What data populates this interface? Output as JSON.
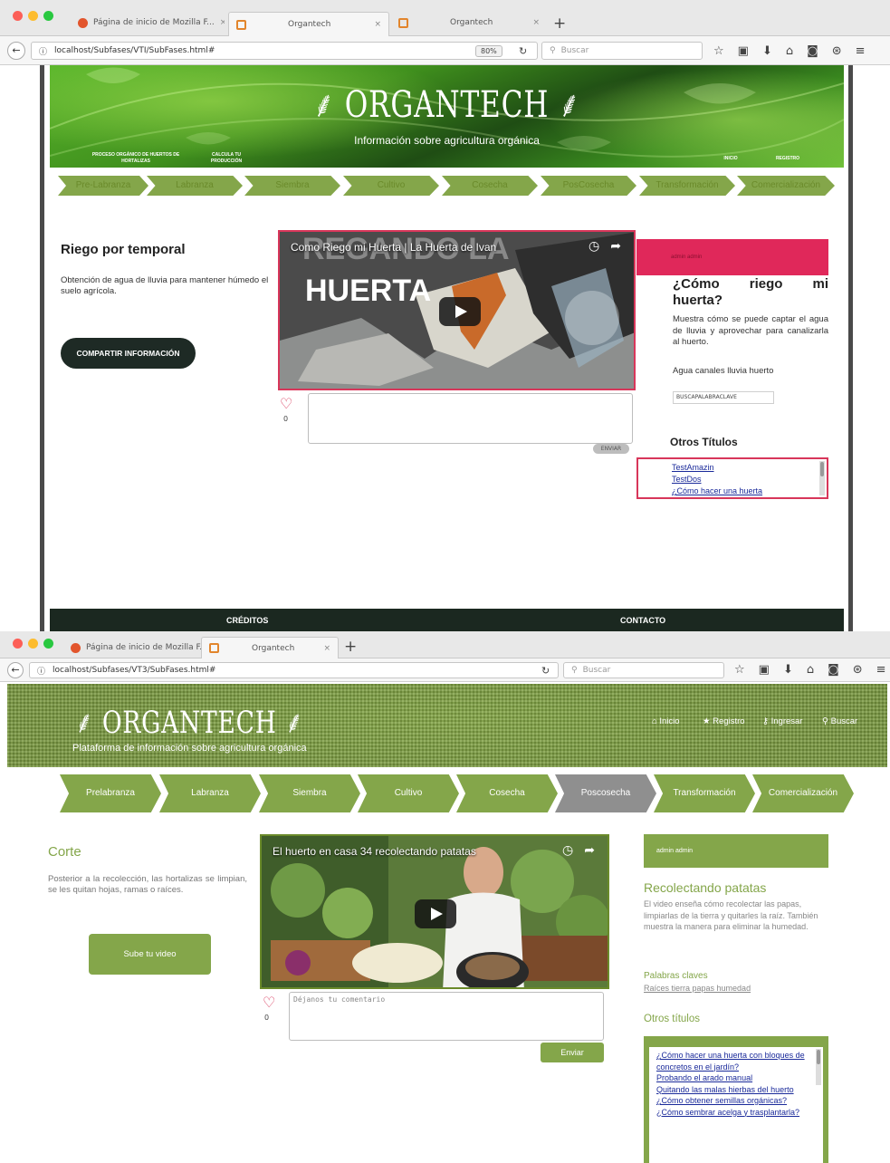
{
  "screen1": {
    "browser": {
      "tabs": [
        "Página de inicio de Mozilla F...",
        "Organtech",
        "Organtech"
      ],
      "url": "localhost/Subfases/VTI/SubFases.html#",
      "zoom": "80%",
      "search_placeholder": "Buscar"
    },
    "header": {
      "logo": "ORGANTECH",
      "tagline": "Información sobre agricultura orgánica",
      "nav": [
        "PROCESO ORGÁNICO DE HUERTOS DE HORTALIZAS",
        "CALCULA TU PRODUCCIÓN",
        "INICIO",
        "REGISTRO"
      ]
    },
    "steps": [
      "Pre-Labranza",
      "Labranza",
      "Siembra",
      "Cultivo",
      "Cosecha",
      "PosCosecha",
      "Transformación",
      "Comercialización"
    ],
    "subphase": {
      "title": "Riego por temporal",
      "description": "Obtención de agua de lluvia para mantener húmedo el suelo agrícola.",
      "share_button": "COMPARTIR INFORMACIÓN"
    },
    "video": {
      "title": "Como Riego mi Huerta | La Huerta de Ivan",
      "overlay_line1": "REGANDO LA",
      "overlay_line2": "HUERTA",
      "likes": "0",
      "send_label": "ENVIAR"
    },
    "sidebar": {
      "user": "admin admin",
      "video_title": "¿Cómo riego mi huerta?",
      "video_description": "Muestra cómo se puede captar el agua de lluvia y aprovechar para canalizarla al huerto.",
      "keywords": "Agua canales lluvia huerto",
      "keyword_input": "BUSCAPALABRACLAVE",
      "other_titles_label": "Otros Títulos",
      "other_titles": [
        "TestAmazin",
        "TestDos",
        "¿Cómo hacer una huerta"
      ]
    },
    "footer": {
      "credits": "CRÉDITOS",
      "contact": "CONTACTO"
    }
  },
  "screen2": {
    "browser": {
      "tabs": [
        "Página de inicio de Mozilla F...",
        "Organtech"
      ],
      "url": "localhost/Subfases/VT3/SubFases.html#",
      "search_placeholder": "Buscar"
    },
    "header": {
      "logo": "ORGANTECH",
      "tagline": "Plataforma de información sobre agricultura orgánica",
      "menu": [
        {
          "icon": "home-icon",
          "label": "Inicio"
        },
        {
          "icon": "star-icon",
          "label": "Registro"
        },
        {
          "icon": "key-icon",
          "label": "Ingresar"
        },
        {
          "icon": "search-icon",
          "label": "Buscar"
        }
      ]
    },
    "steps": [
      "Prelabranza",
      "Labranza",
      "Siembra",
      "Cultivo",
      "Cosecha",
      "Poscosecha",
      "Transformación",
      "Comercialización"
    ],
    "active_step": "Poscosecha",
    "subphase": {
      "title": "Corte",
      "description": "Posterior a la recolección, las hortalizas se limpian, se les quitan hojas, ramas o raíces.",
      "upload_button": "Sube tu video"
    },
    "video": {
      "title": "El huerto en casa 34 recolectando patatas",
      "likes": "0",
      "comment_placeholder": "Déjanos tu comentario",
      "send_label": "Enviar"
    },
    "sidebar": {
      "user": "admin admin",
      "video_title": "Recolectando patatas",
      "video_description": "El video enseña cómo recolectar las papas, limpiarlas de la tierra y quitarles la raíz. También muestra la manera para eliminar la humedad.",
      "keywords_label": "Palabras claves",
      "keywords": "Raíces tierra papas humedad",
      "other_titles_label": "Otros títulos",
      "other_titles": [
        "¿Cómo hacer una huerta con bloques de concretos en el jardín?",
        "Probando el arado manual",
        "Quitando las malas hierbas del huerto",
        "¿Cómo obtener semillas orgánicas?",
        "¿Cómo sembrar acelga y trasplantarla?"
      ]
    }
  },
  "colors": {
    "brand_green": "#84a64a",
    "accent_pink": "#d8365a",
    "footer_dark": "#1b2820"
  }
}
